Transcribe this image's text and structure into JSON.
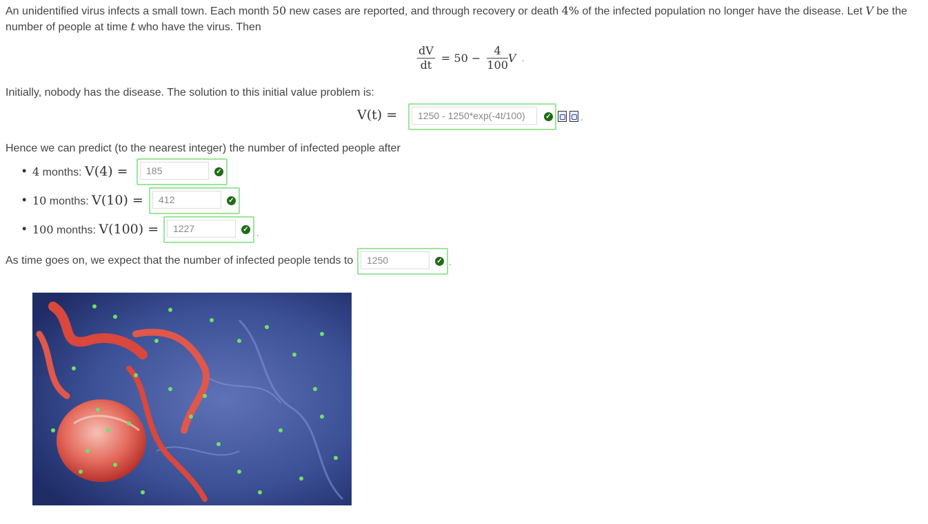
{
  "intro": {
    "t1": "An unidentified virus infects a small town.  Each month ",
    "n1": "50",
    "t2": "  new cases are reported, and through recovery or death ",
    "n2": "4%",
    "t3": "  of the infected population no longer have the disease. Let ",
    "var": "V",
    "t4": " be the number of people at time ",
    "tvar": "t",
    "t5": " who have the virus. Then"
  },
  "equation": {
    "lhs_num": "dV",
    "lhs_den": "dt",
    "eq": "= 50 −",
    "rhs_num": "4",
    "rhs_den": "100",
    "rhs_var": "V",
    "end": "."
  },
  "ivp": {
    "text": "Initially, nobody has the disease. The solution to this initial value problem is:",
    "label": "V(t) =",
    "answer": "1250 - 1250*exp(-4t/100)"
  },
  "predict": {
    "text": "Hence we can predict (to the nearest integer) the number of infected people after",
    "items": [
      {
        "label_a": "4",
        "label_b": " months: ",
        "expr": "V(4) =",
        "answer": "185"
      },
      {
        "label_a": "10",
        "label_b": " months: ",
        "expr": "V(10) =",
        "answer": "412"
      },
      {
        "label_a": "100",
        "label_b": " months: ",
        "expr": "V(100) =",
        "answer": "1227"
      }
    ]
  },
  "limit": {
    "text": "As time goes on, we expect that the number of infected people tends to",
    "answer": "1250"
  },
  "colors": {
    "correct_border": "#9be59b",
    "check_green": "#1f6b16"
  },
  "icons": [
    "check-icon",
    "preview-doc-icon",
    "help-doc-icon"
  ]
}
